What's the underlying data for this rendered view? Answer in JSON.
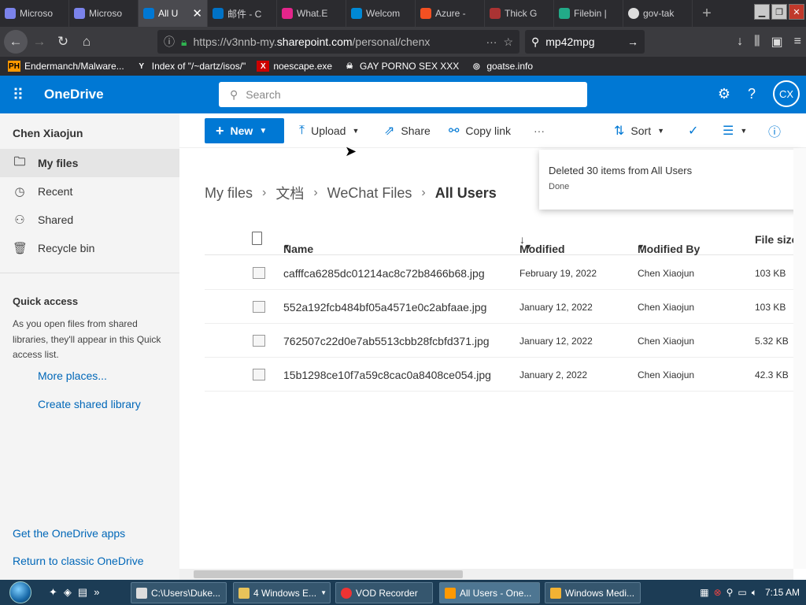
{
  "browser": {
    "tabs": [
      {
        "label": "Microso",
        "color": "#7b83eb"
      },
      {
        "label": "Microso",
        "color": "#7b83eb"
      },
      {
        "label": "All U",
        "color": "#0078d4",
        "active": true
      },
      {
        "label": "邮件 - C",
        "color": "#0072c6"
      },
      {
        "label": "What.E",
        "color": "#e3258b"
      },
      {
        "label": "Welcom",
        "color": "#0089d6"
      },
      {
        "label": "Azure -",
        "color": "#f25022"
      },
      {
        "label": "Thick G",
        "color": "#a33"
      },
      {
        "label": "Filebin |",
        "color": "#2a8"
      },
      {
        "label": "gov-tak",
        "color": "#ddd"
      }
    ],
    "url_prefix": "https://v3nnb-my.",
    "url_domain": "sharepoint.com",
    "url_path": "/personal/chenx",
    "search_value": "mp42mpg",
    "bookmarks": [
      {
        "label": "Endermanch/Malware...",
        "icon": "PH"
      },
      {
        "label": "Index of \"/~dartz/isos/\"",
        "icon": "Y"
      },
      {
        "label": "noescape.exe",
        "icon": "X"
      },
      {
        "label": "GAY PORNO SEX XXX",
        "icon": "☠"
      },
      {
        "label": "goatse.info",
        "icon": "◎"
      }
    ]
  },
  "onedrive": {
    "brand": "OneDrive",
    "search_placeholder": "Search",
    "avatar": "CX"
  },
  "sidebar": {
    "user": "Chen Xiaojun",
    "items": [
      {
        "label": "My files",
        "icon": "folder-icon",
        "selected": true
      },
      {
        "label": "Recent",
        "icon": "clock-icon"
      },
      {
        "label": "Shared",
        "icon": "people-icon"
      },
      {
        "label": "Recycle bin",
        "icon": "trash-icon"
      }
    ],
    "quick_access_title": "Quick access",
    "quick_access_desc": "As you open files from shared libraries, they'll appear in this Quick access list.",
    "more_places": "More places...",
    "create_library": "Create shared library",
    "get_apps": "Get the OneDrive apps",
    "return_classic": "Return to classic OneDrive"
  },
  "commands": {
    "new": "New",
    "upload": "Upload",
    "share": "Share",
    "copy_link": "Copy link",
    "more": "···",
    "sort": "Sort"
  },
  "toast": {
    "message": "Deleted 30 items from All Users",
    "status": "Done"
  },
  "breadcrumb": [
    "My files",
    "文档",
    "WeChat Files",
    "All Users"
  ],
  "table": {
    "columns": {
      "name": "Name",
      "modified": "Modified",
      "modified_by": "Modified By",
      "file_size": "File size"
    },
    "rows": [
      {
        "name": "cafffca6285dc01214ac8c72b8466b68.jpg",
        "modified": "February 19, 2022",
        "modified_by": "Chen Xiaojun",
        "size": "103 KB"
      },
      {
        "name": "552a192fcb484bf05a4571e0c2abfaae.jpg",
        "modified": "January 12, 2022",
        "modified_by": "Chen Xiaojun",
        "size": "103 KB"
      },
      {
        "name": "762507c22d0e7ab5513cbb28fcbfd371.jpg",
        "modified": "January 12, 2022",
        "modified_by": "Chen Xiaojun",
        "size": "5.32 KB"
      },
      {
        "name": "15b1298ce10f7a59c8cac0a8408ce054.jpg",
        "modified": "January 2, 2022",
        "modified_by": "Chen Xiaojun",
        "size": "42.3 KB"
      }
    ]
  },
  "taskbar": {
    "tasks": [
      {
        "label": "C:\\Users\\Duke..."
      },
      {
        "label": "4 Windows E..."
      },
      {
        "label": "VOD Recorder"
      },
      {
        "label": "All Users - One...",
        "active": true
      },
      {
        "label": "Windows Medi..."
      }
    ],
    "clock": "7:15 AM"
  },
  "colors": {
    "accent": "#0078d4",
    "taskbar": "#1c3c55"
  }
}
